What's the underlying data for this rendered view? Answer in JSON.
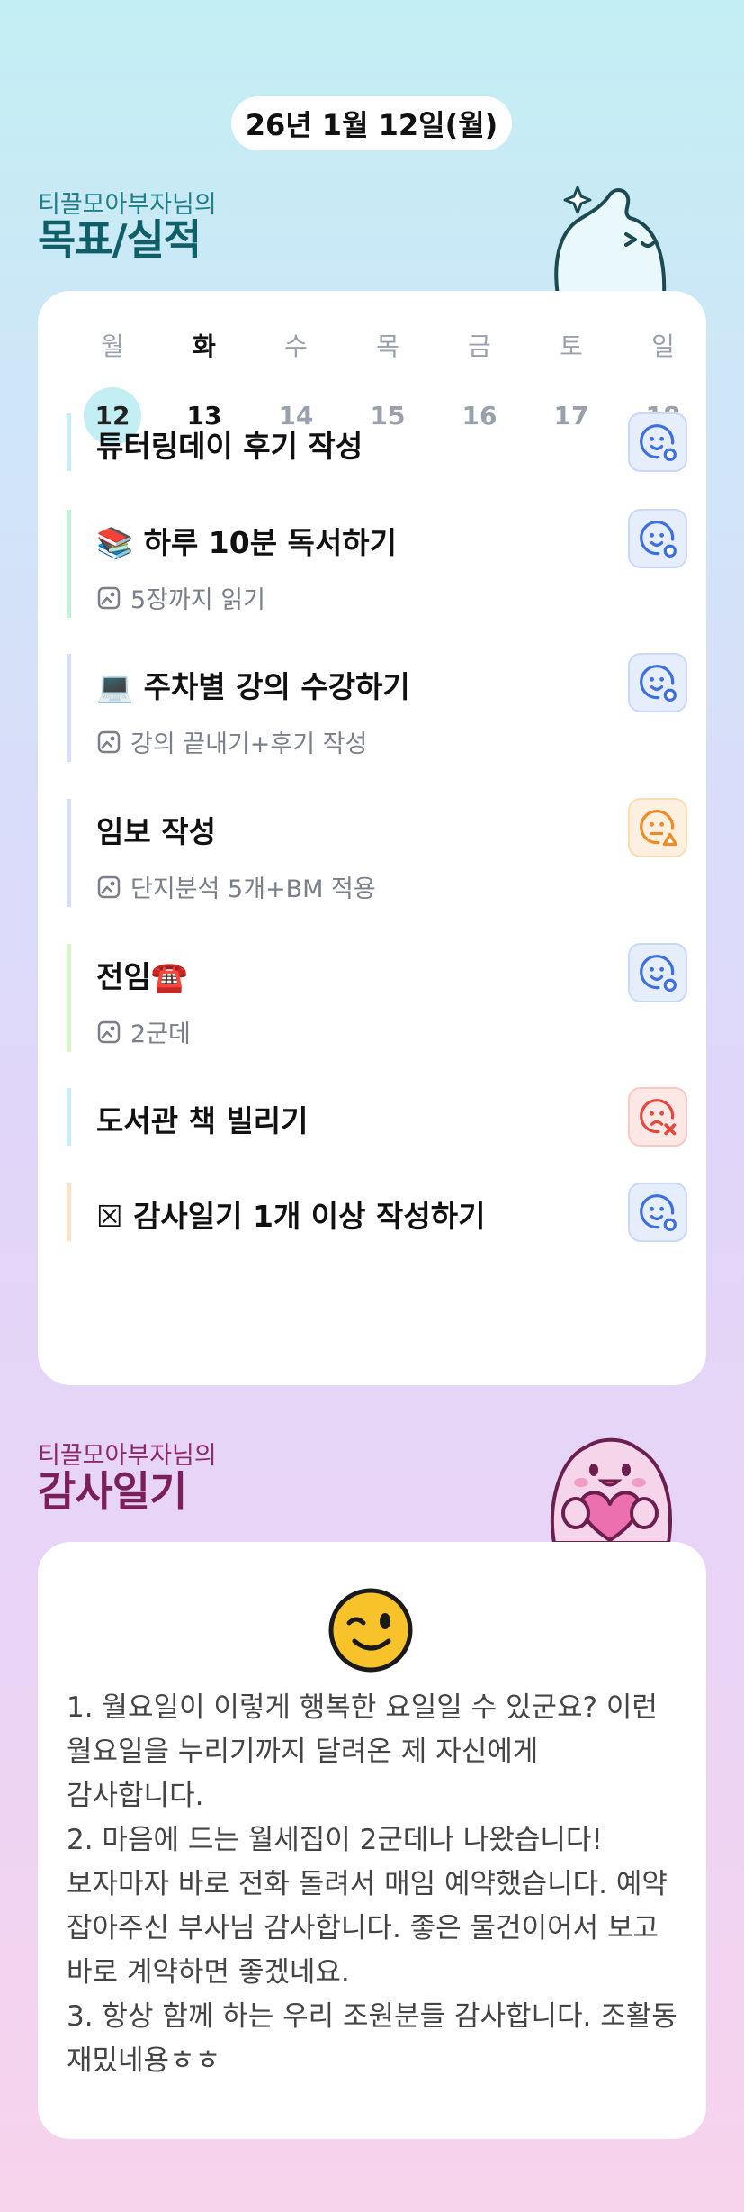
{
  "header": {
    "date": "26년 1월 12일(월)"
  },
  "goals_section": {
    "subtitle": "티끌모아부자님의",
    "title": "목표/실적"
  },
  "week": {
    "days": [
      "월",
      "화",
      "수",
      "목",
      "금",
      "토",
      "일"
    ],
    "dates": [
      "12",
      "13",
      "14",
      "15",
      "16",
      "17",
      "18"
    ],
    "today_index": 0,
    "bold_index": 1
  },
  "goals": [
    {
      "title": "튜터링데이 후기 작성",
      "desc": "",
      "status": "done",
      "bar": "#c6eef4"
    },
    {
      "title": "📚 하루 10분 독서하기",
      "desc": "5장까지 읽기",
      "status": "done",
      "bar": "#c2f0d8"
    },
    {
      "title": "💻 주차별 강의 수강하기",
      "desc": "강의 끝내기+후기 작성",
      "status": "done",
      "bar": "#d7ddfb"
    },
    {
      "title": "임보 작성",
      "desc": "단지분석 5개+BM 적용",
      "status": "partial",
      "bar": "#d7ddfb"
    },
    {
      "title": "전임☎️",
      "desc": "2군데",
      "status": "done",
      "bar": "#daf3c6"
    },
    {
      "title": "도서관 책 빌리기",
      "desc": "",
      "status": "fail",
      "bar": "#c6eef4"
    },
    {
      "title": "☒ 감사일기 1개 이상 작성하기",
      "desc": "",
      "status": "done",
      "bar": "#fde2c8"
    }
  ],
  "gratitude_section": {
    "subtitle": "티끌모아부자님의",
    "title": "감사일기"
  },
  "gratitude": {
    "text": "1. 월요일이 이렇게 행복한 요일일 수 있군요? 이런 월요일을 누리기까지 달려온 제 자신에게 감사합니다.\n2. 마음에 드는 월세집이 2군데나 나왔습니다! 보자마자 바로 전화 돌려서 매임 예약했습니다. 예약 잡아주신 부사님 감사합니다. 좋은 물건이어서 보고 바로 계약하면 좋겠네요.\n3. 항상 함께 하는 우리 조원분들 감사합니다. 조활동 재밌네용ㅎㅎ"
  },
  "colors": {
    "done": "#3d6fe0",
    "partial": "#f08a24",
    "fail": "#e5483d"
  }
}
